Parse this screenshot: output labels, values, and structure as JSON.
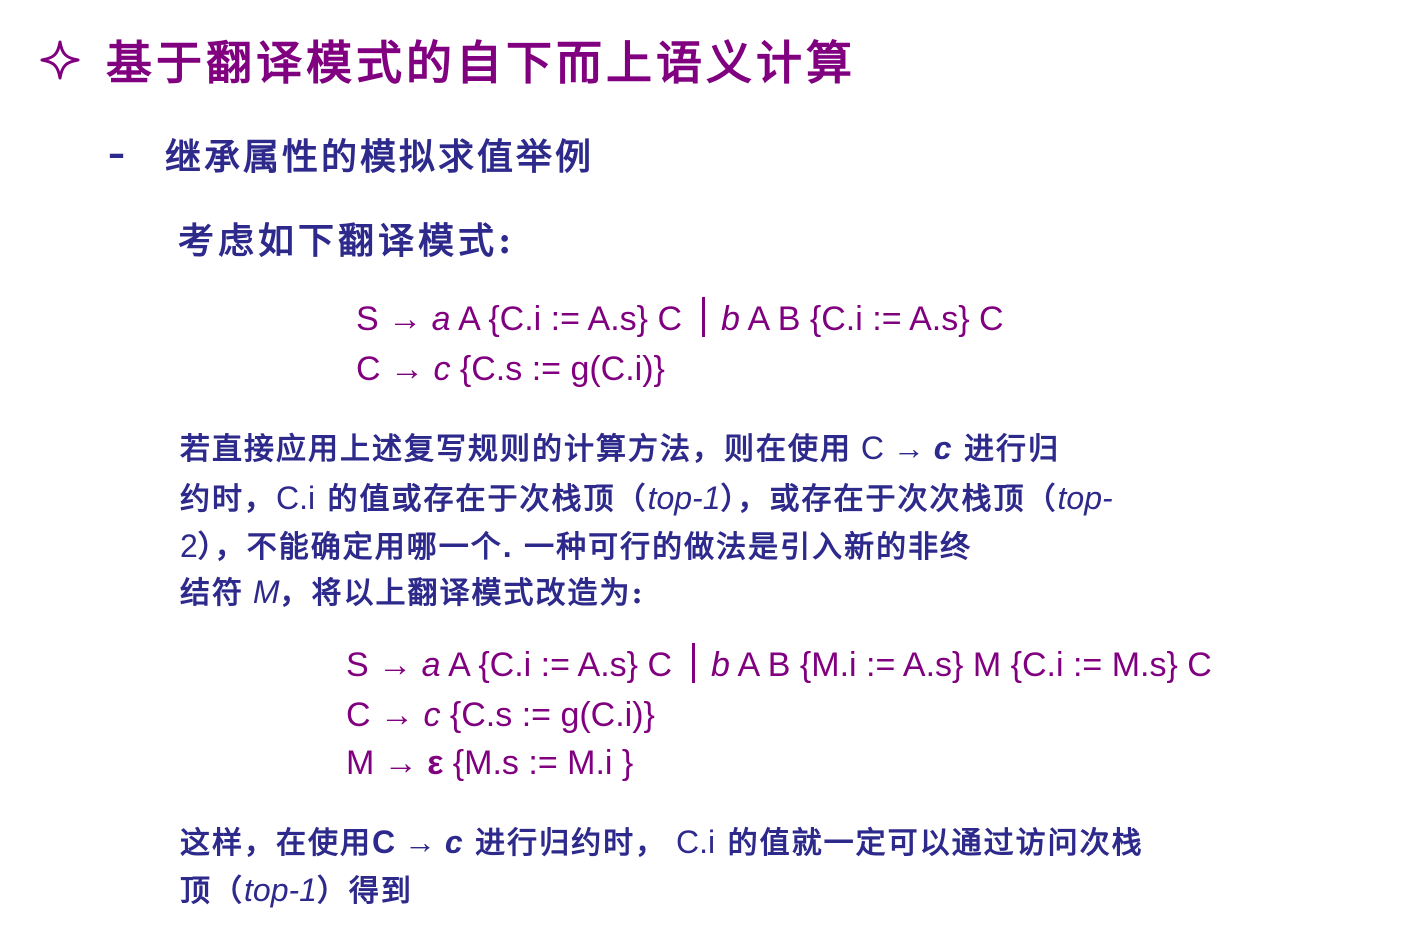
{
  "title": "基于翻译模式的自下而上语义计算",
  "subtitle": "继承属性的模拟求值举例",
  "intro": "考虑如下翻译模式:",
  "scheme1": {
    "line1_left": [
      "S → ",
      "a",
      " A {C.i := A.s} C"
    ],
    "line1_right": [
      "b",
      " A B {C.i := A.s} C"
    ],
    "line2": [
      "C → ",
      "c",
      " {C.s := g(C.i)}"
    ]
  },
  "para1": {
    "l1a": "若直接应用上述复写规则的计算方法，则在使用",
    "l1b": " C → ",
    "l1c": "c",
    "l1d": " 进行归",
    "l2a": "约时，",
    "l2b": "C.i",
    "l2c": " 的值或存在于次栈顶（",
    "l2d": "top-1",
    "l2e": "），或存在于次次栈顶（",
    "l2f": "top-",
    "l3a": "2",
    "l3b": "），不能确定用哪一个",
    "l3c": ".",
    "l3d": " 一种可行的做法是引入新的非终",
    "l4a": "结符",
    "l4b": " M",
    "l4c": "，将以上翻译模式改造为:"
  },
  "scheme2": {
    "line1_left": [
      "S → ",
      "a",
      " A {C.i := A.s} C"
    ],
    "line1_right": [
      "b",
      " A B {M.i := A.s} M {C.i := M.s} C"
    ],
    "line2": [
      "C → ",
      "c",
      "  {C.s := g(C.i)}"
    ],
    "line3": [
      "M → ",
      "ε",
      "  {M.s := M.i }"
    ]
  },
  "para2": {
    "l1a": "这样，在使用",
    "l1b": "C → ",
    "l1c": "c",
    "l1d": " 进行归约时，",
    "l1e": " C.i",
    "l1f": " 的值就一定可以通过访问次栈",
    "l2a": "顶（",
    "l2b": "top-1",
    "l2c": "）得到"
  },
  "colors": {
    "title": "#800080",
    "body": "#2e2a8c",
    "formula": "#800080"
  },
  "icons": {
    "title_bullet": "four-point-star-icon"
  }
}
